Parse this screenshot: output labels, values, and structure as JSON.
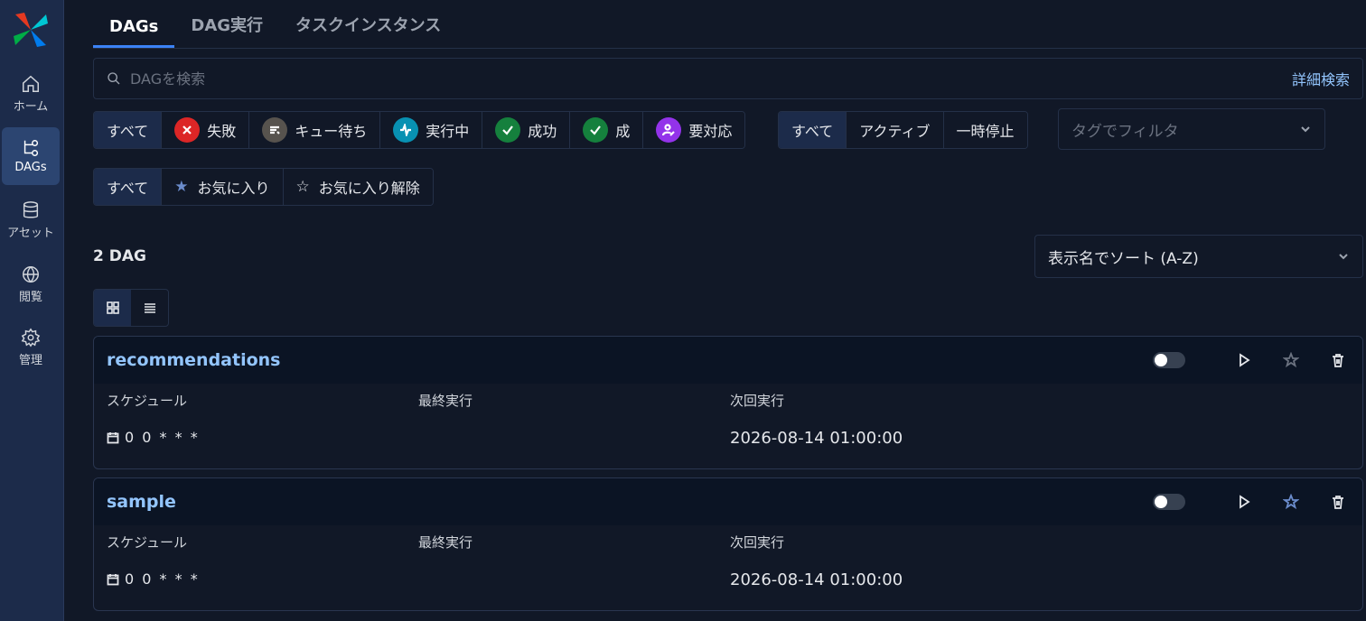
{
  "sidebar": {
    "items": [
      {
        "label": "ホーム",
        "icon": "home-icon"
      },
      {
        "label": "DAGs",
        "icon": "dags-icon"
      },
      {
        "label": "アセット",
        "icon": "database-icon"
      },
      {
        "label": "閲覧",
        "icon": "globe-icon"
      },
      {
        "label": "管理",
        "icon": "gear-icon"
      }
    ]
  },
  "tabs": [
    {
      "label": "DAGs"
    },
    {
      "label": "DAG実行"
    },
    {
      "label": "タスクインスタンス"
    }
  ],
  "search": {
    "placeholder": "DAGを検索",
    "advanced_label": "詳細検索"
  },
  "state_filters": [
    {
      "label": "すべて"
    },
    {
      "label": "失敗",
      "icon": "x-icon",
      "color": "#dc2626"
    },
    {
      "label": "キュー待ち",
      "icon": "queue-icon",
      "color": "#6b7280"
    },
    {
      "label": "実行中",
      "icon": "activity-icon",
      "color": "#06b6d4"
    },
    {
      "label": "成功",
      "icon": "check-icon",
      "color": "#16a34a"
    },
    {
      "label": "成",
      "icon": "check-icon",
      "color": "#16a34a"
    },
    {
      "label": "要対応",
      "icon": "user-edit-icon",
      "color": "#a855f7"
    }
  ],
  "active_filters": [
    {
      "label": "すべて"
    },
    {
      "label": "アクティブ"
    },
    {
      "label": "一時停止"
    }
  ],
  "tag_filter": {
    "placeholder": "タグでフィルタ"
  },
  "favorite_filters": [
    {
      "label": "すべて"
    },
    {
      "label": "お気に入り"
    },
    {
      "label": "お気に入り解除"
    }
  ],
  "dag_count": "2 DAG",
  "sort": {
    "label": "表示名でソート (A-Z)"
  },
  "columns": {
    "schedule": "スケジュール",
    "last_run": "最終実行",
    "next_run": "次回実行"
  },
  "dags": [
    {
      "name": "recommendations",
      "schedule": "0 0 * * *",
      "next_run": "2026-08-14 01:00:00"
    },
    {
      "name": "sample",
      "schedule": "0 0 * * *",
      "next_run": "2026-08-14 01:00:00"
    }
  ]
}
